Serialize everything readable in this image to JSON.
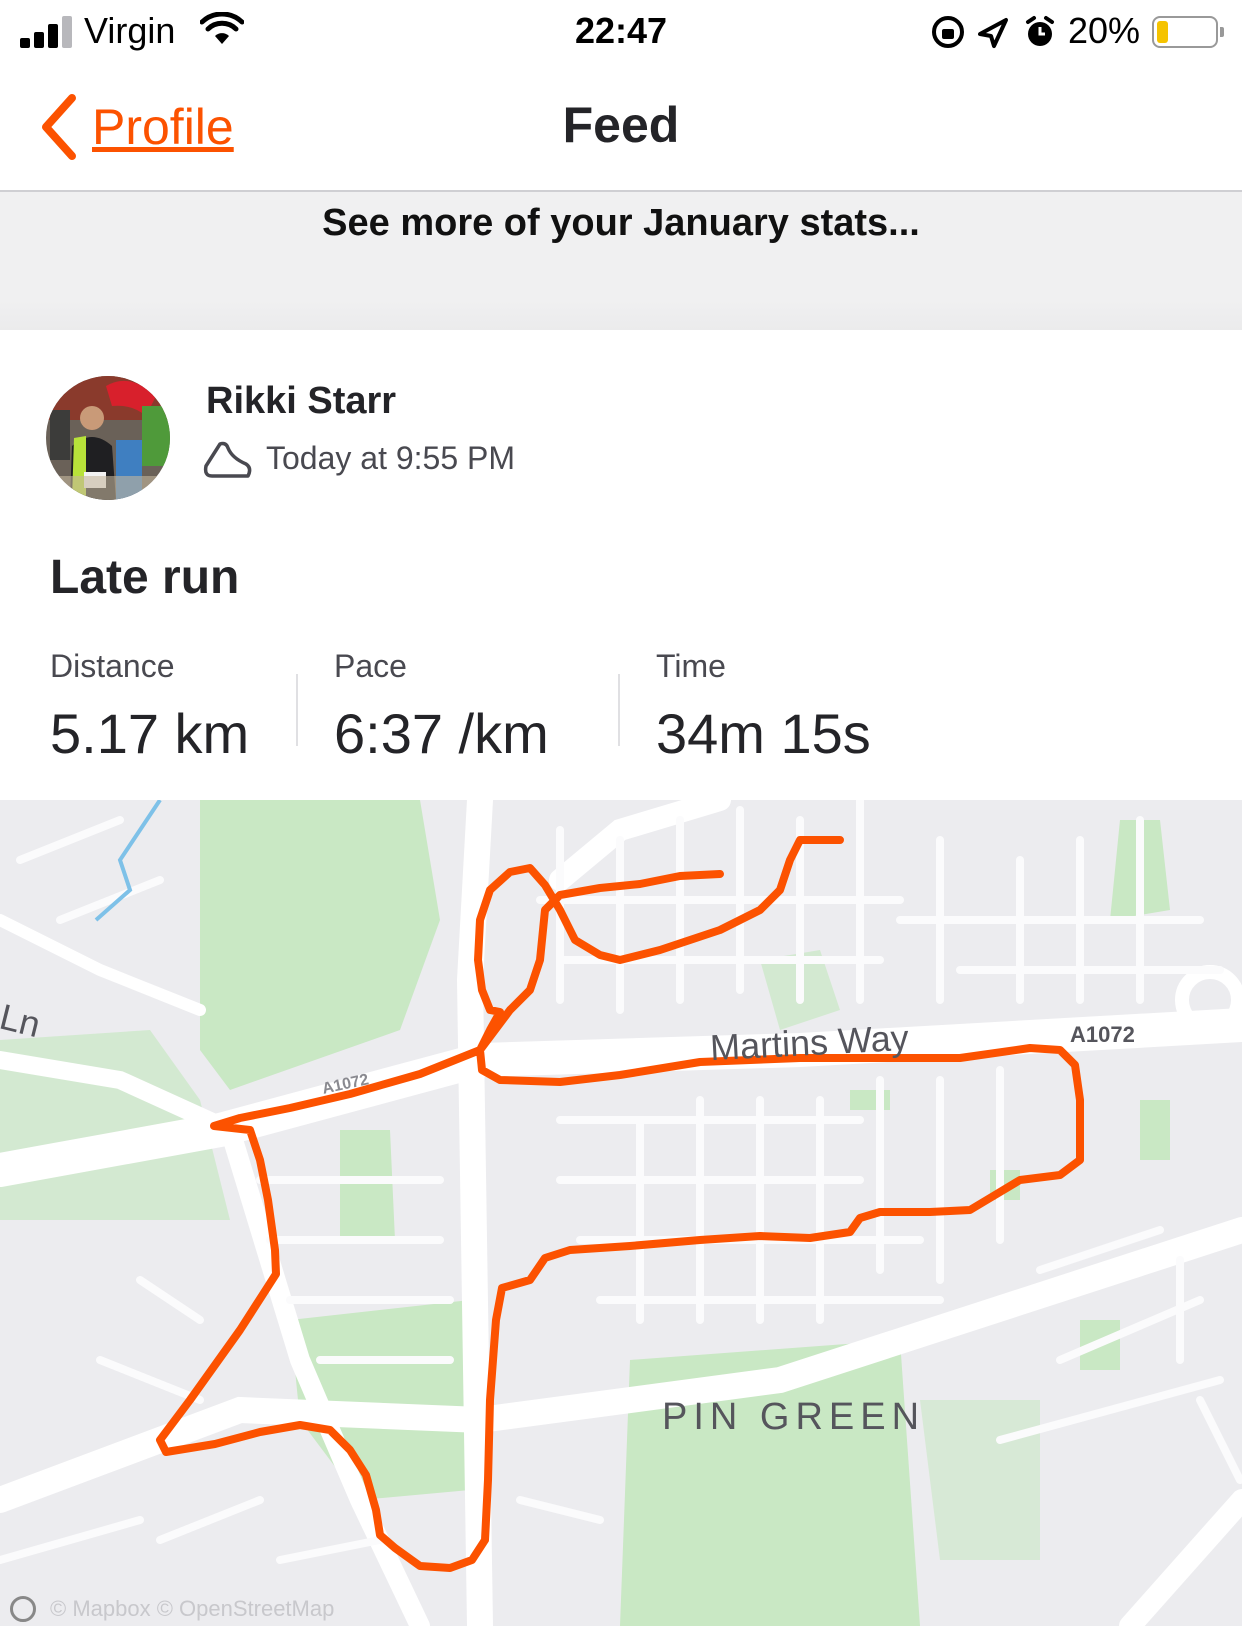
{
  "status_bar": {
    "carrier": "Virgin",
    "time": "22:47",
    "battery_percent": "20%",
    "battery_level": 0.2
  },
  "nav": {
    "back_label": "Profile",
    "title": "Feed"
  },
  "banner": {
    "text": "See more of your January stats..."
  },
  "activity": {
    "athlete_name": "Rikki Starr",
    "timestamp": "Today at 9:55 PM",
    "title": "Late run",
    "stats": [
      {
        "label": "Distance",
        "value": "5.17 km"
      },
      {
        "label": "Pace",
        "value": "6:37 /km"
      },
      {
        "label": "Time",
        "value": "34m 15s"
      }
    ]
  },
  "map": {
    "labels": {
      "road_1": "Martins Way",
      "road_2": "A1072",
      "road_3": "A1072",
      "area": "PIN GREEN",
      "lane": "Ln"
    },
    "attribution": "© Mapbox © OpenStreetMap",
    "route_color": "#fc5200",
    "park_color": "#c9e8c4",
    "road_color": "#ffffff"
  },
  "colors": {
    "accent": "#fc5200",
    "text": "#242428",
    "banner_bg": "#f0f0f1"
  }
}
